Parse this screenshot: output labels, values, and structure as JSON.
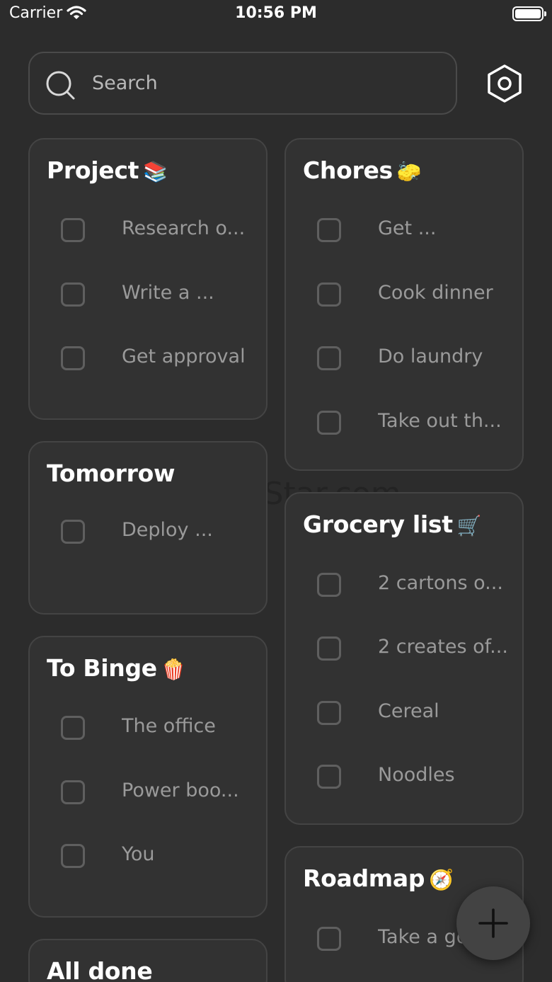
{
  "status_bar": {
    "carrier": "Carrier",
    "time": "10:56 PM"
  },
  "search": {
    "placeholder": "Search",
    "value": ""
  },
  "icons": {
    "search": "search-icon",
    "settings": "hexagon-gear-icon",
    "add": "plus-icon"
  },
  "watermark": "UpdateStar.com",
  "lists": [
    {
      "title": "Project",
      "emoji": "📚",
      "items": [
        "Research o...",
        "Write a ...",
        "Get approval"
      ]
    },
    {
      "title": "Tomorrow",
      "emoji": "",
      "items": [
        "Deploy ..."
      ]
    },
    {
      "title": "To Binge",
      "emoji": "🍿",
      "items": [
        "The office",
        "Power boo...",
        "You"
      ]
    },
    {
      "title": "All done",
      "emoji": "",
      "items": []
    },
    {
      "title": "Chores",
      "emoji": "🧽",
      "items": [
        "Get ...",
        "Cook dinner",
        "Do laundry",
        "Take out th..."
      ]
    },
    {
      "title": "Grocery list",
      "emoji": "🛒",
      "items": [
        "2 cartons o...",
        "2 creates of...",
        "Cereal",
        "Noodles"
      ]
    },
    {
      "title": "Roadmap",
      "emoji": "🧭",
      "items": [
        "Take a go"
      ]
    }
  ],
  "colors": {
    "background": "#2c2c2c",
    "card": "#323232",
    "card_border": "#444444",
    "muted_text": "#9a9a9a",
    "fab": "#434343"
  }
}
